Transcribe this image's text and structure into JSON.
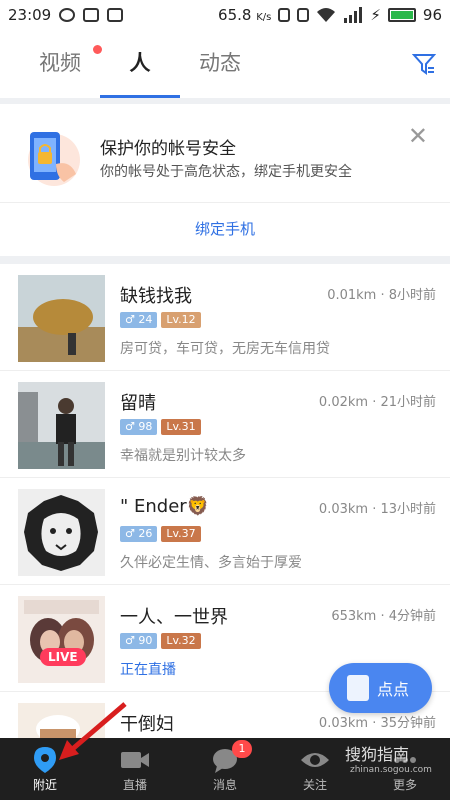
{
  "status_bar": {
    "time": "23:09",
    "speed": "65.8",
    "speed_unit": "K/s",
    "battery": "96"
  },
  "tabs": [
    {
      "label": "视频"
    },
    {
      "label": "人"
    },
    {
      "label": "动态"
    }
  ],
  "banner": {
    "title": "保护你的帐号安全",
    "desc": "你的帐号处于高危状态，绑定手机更安全",
    "close": "✕",
    "bind_label": "绑定手机"
  },
  "people": [
    {
      "name": "缺钱找我",
      "distance": "0.01km · 8小时前",
      "age": "24",
      "level": "Lv.12",
      "signature": "房可贷，车可贷，无房无车信用贷"
    },
    {
      "name": "留晴",
      "distance": "0.02km · 21小时前",
      "age": "98",
      "level": "Lv.31",
      "signature": "幸福就是别计较太多"
    },
    {
      "name": "\" Ender🦁",
      "distance": "0.03km · 13小时前",
      "age": "26",
      "level": "Lv.37",
      "signature": "久伴必定生情、多言始于厚爱"
    },
    {
      "name": "一人、一世界",
      "distance": "653km · 4分钟前",
      "age": "90",
      "level": "Lv.32",
      "signature": "正在直播",
      "live_tag": "LIVE"
    },
    {
      "name": "干倒妇",
      "distance": "0.03km · 35分钟前"
    }
  ],
  "fab": {
    "label": "点点"
  },
  "nav": [
    {
      "label": "附近"
    },
    {
      "label": "直播"
    },
    {
      "label": "消息",
      "badge": "1"
    },
    {
      "label": "关注"
    },
    {
      "label": "更多"
    }
  ],
  "watermark": {
    "text": "搜狗指南",
    "url": "zhinan.sogou.com"
  }
}
